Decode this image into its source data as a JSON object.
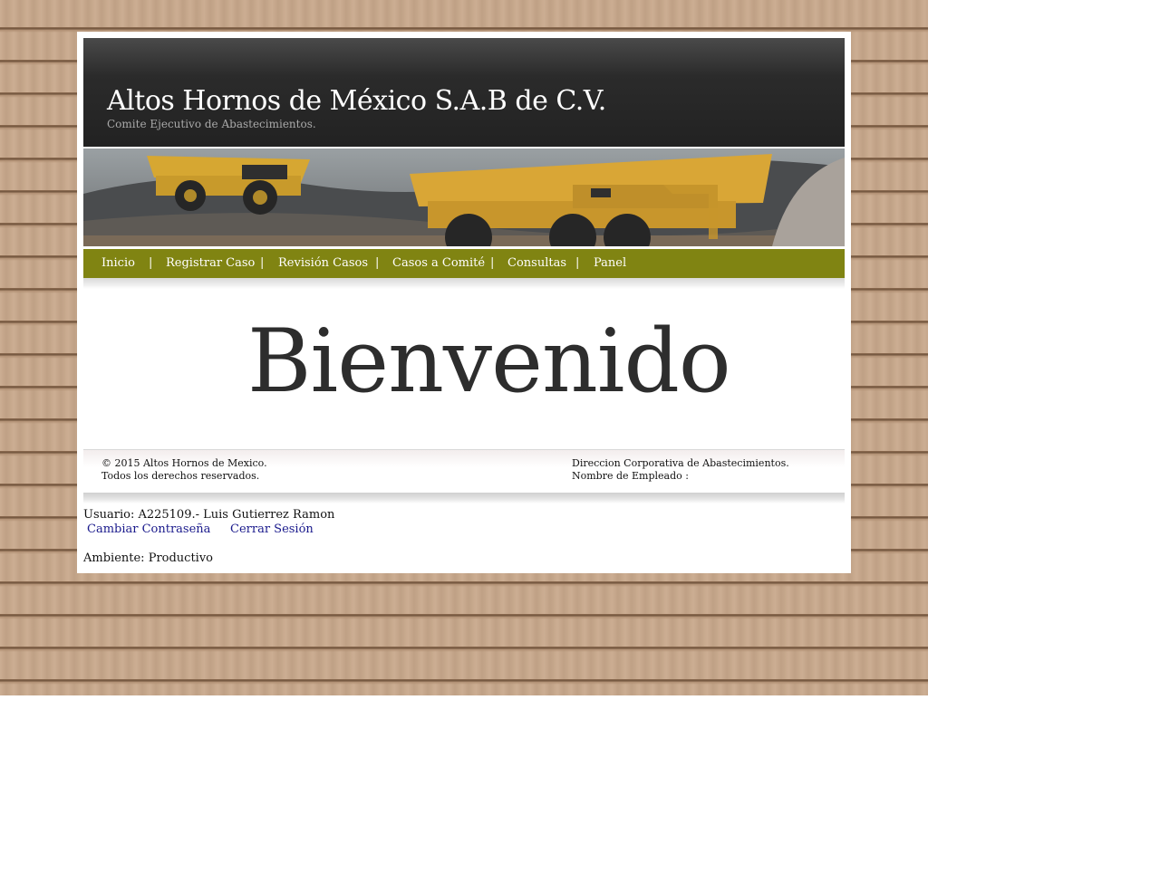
{
  "header": {
    "title": "Altos Hornos de México S.A.B de C.V.",
    "subtitle": "Comite Ejecutivo de Abastecimientos."
  },
  "banner": {
    "icon": "mining-trucks-photo"
  },
  "nav": {
    "items": [
      {
        "label": "Inicio"
      },
      {
        "label": "Registrar Caso"
      },
      {
        "label": "Revisión Casos"
      },
      {
        "label": "Casos a Comité"
      },
      {
        "label": "Consultas"
      },
      {
        "label": "Panel"
      }
    ],
    "separator": "|"
  },
  "main": {
    "welcome": "Bienvenido"
  },
  "footer": {
    "copyright": "© 2015 Altos Hornos de Mexico.",
    "rights": "Todos los derechos reservados.",
    "direccion": "Direccion Corporativa de Abastecimientos.",
    "empleado": "Nombre de Empleado :"
  },
  "session": {
    "usuario": "Usuario: A225109.- Luis Gutierrez Ramon",
    "change_password": "Cambiar Contraseña",
    "logout": "Cerrar Sesión",
    "ambiente": "Ambiente: Productivo"
  },
  "colors": {
    "nav_bg": "#808412",
    "header_bg": "#2b2b2b",
    "link": "#1a1a8c"
  }
}
